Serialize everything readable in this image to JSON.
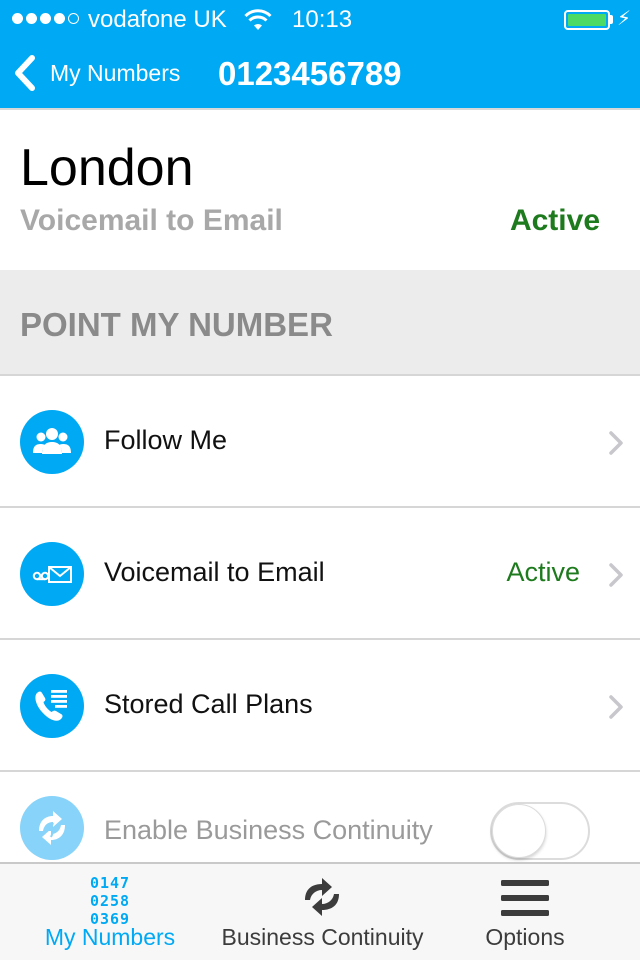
{
  "status_bar": {
    "carrier": "vodafone UK",
    "time": "10:13",
    "signal_bars_filled": 4,
    "signal_bars_total": 5,
    "battery_level": 1.0
  },
  "nav": {
    "back_label": "My Numbers",
    "title": "0123456789"
  },
  "location": {
    "name": "London",
    "service": "Voicemail to Email",
    "status": "Active"
  },
  "section": {
    "title": "POINT MY NUMBER"
  },
  "rows": [
    {
      "label": "Follow Me",
      "status": "",
      "icon": "people-group-icon"
    },
    {
      "label": "Voicemail to Email",
      "status": "Active",
      "icon": "voicemail-envelope-icon"
    },
    {
      "label": "Stored Call Plans",
      "status": "",
      "icon": "phone-list-icon"
    },
    {
      "label": "Enable Business Continuity",
      "status": "",
      "icon": "continuity-arrows-icon",
      "toggle_on": false
    }
  ],
  "tabbar": {
    "tabs": [
      {
        "label": "My  Numbers",
        "digits": [
          "0147",
          "0258",
          "0369"
        ],
        "active": true
      },
      {
        "label": "Business  Continuity",
        "active": false
      },
      {
        "label": "Options",
        "active": false
      }
    ]
  },
  "colors": {
    "brand_blue": "#00a9f4",
    "active_green": "#1d7a1d",
    "section_bg": "#ececec"
  }
}
